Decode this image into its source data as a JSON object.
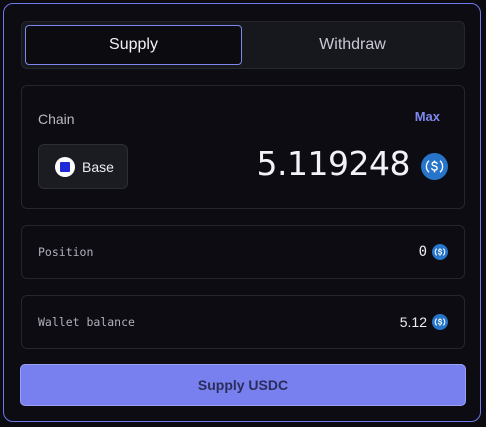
{
  "tabs": {
    "supply_label": "Supply",
    "withdraw_label": "Withdraw",
    "active": "Supply"
  },
  "amount_card": {
    "chain_label": "Chain",
    "max_label": "Max",
    "chain_name": "Base",
    "chain_icon": "base-logo",
    "amount_value": "5.119248",
    "token_icon": "usdc-icon"
  },
  "position": {
    "label": "Position",
    "value": "0",
    "token_icon": "usdc-icon"
  },
  "wallet": {
    "label": "Wallet balance",
    "value": "5.12",
    "token_icon": "usdc-icon"
  },
  "action": {
    "button_label": "Supply USDC"
  },
  "colors": {
    "accent": "#7880f0",
    "usdc": "#2775ca",
    "base": "#1f2bd8"
  }
}
